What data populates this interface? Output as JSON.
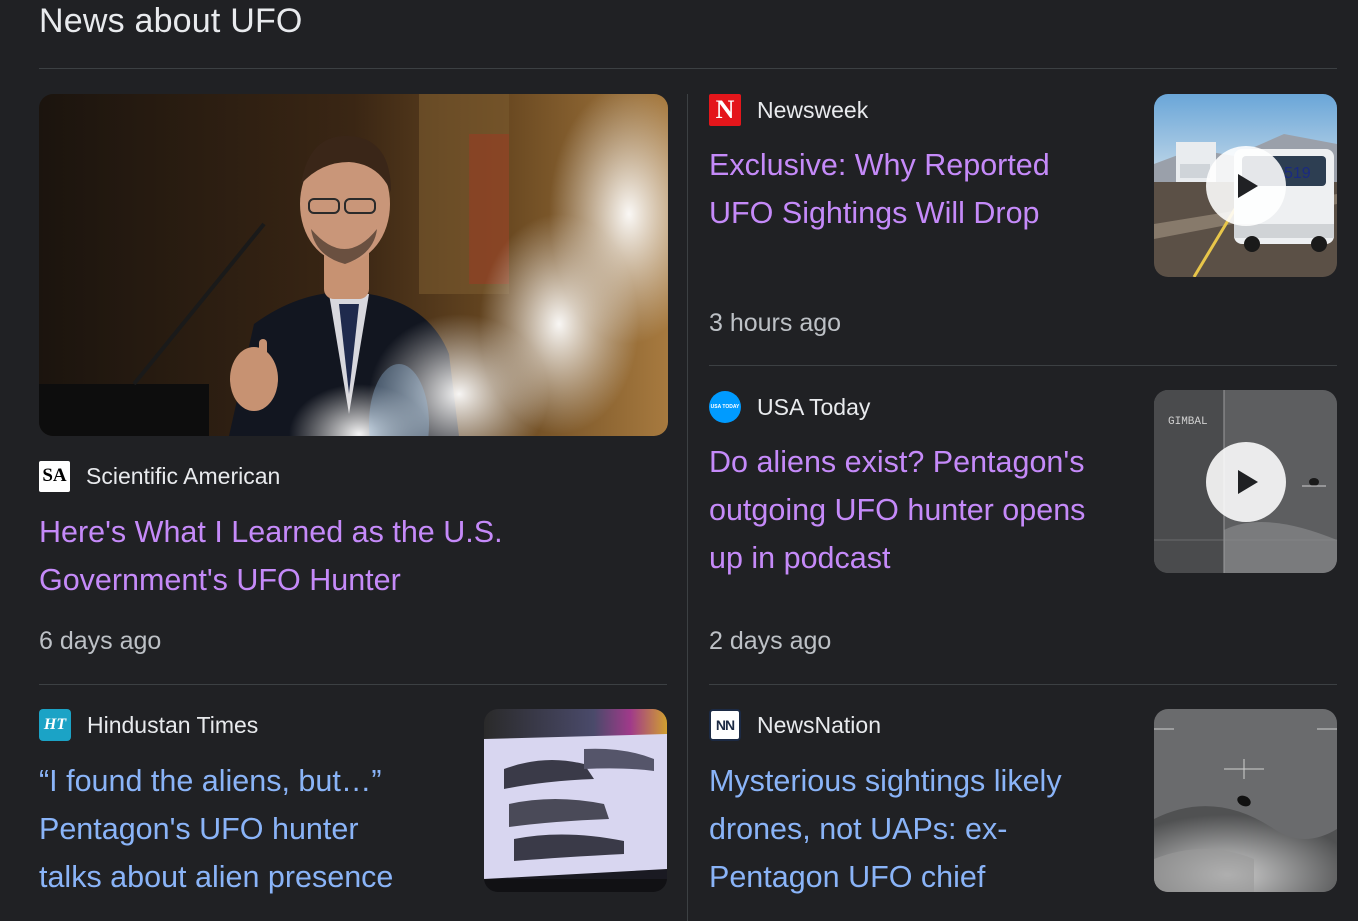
{
  "section": {
    "title": "News about UFO"
  },
  "stories": [
    {
      "source": "Scientific American",
      "logo_text": "SA",
      "headline_line1": "Here's What I Learned as the U.S.",
      "headline_line2": "Government's UFO Hunter",
      "time": "6 days ago",
      "image": "speaker-at-podium-photo",
      "visited": true
    },
    {
      "source": "Newsweek",
      "logo_text": "N",
      "headline_line1": "Exclusive: Why Reported",
      "headline_line2": "UFO Sightings Will Drop",
      "time": "3 hours ago",
      "image": "highway-car-video-thumbnail",
      "has_video": true,
      "visited": true
    },
    {
      "source": "USA Today",
      "logo_text": "USA TODAY",
      "headline_line1": "Do aliens exist? Pentagon's",
      "headline_line2": "outgoing UFO hunter opens",
      "headline_line3": "up in podcast",
      "time": "2 days ago",
      "image": "infrared-ufo-video-thumbnail",
      "thumb_overlay_text": "GIMBAL",
      "has_video": true,
      "visited": true
    },
    {
      "source": "Hindustan Times",
      "logo_text": "HT",
      "headline_line1": "“I found the aliens, but…”",
      "headline_line2": "Pentagon's UFO hunter",
      "headline_line3": "talks about alien presence",
      "image": "alien-bodies-display-photo",
      "visited": false
    },
    {
      "source": "NewsNation",
      "logo_text": "NN",
      "headline_line1": "Mysterious sightings likely",
      "headline_line2": "drones, not UAPs: ex-",
      "headline_line3": "Pentagon UFO chief",
      "image": "infrared-ufo-photo",
      "visited": false
    }
  ],
  "colors": {
    "background": "#202124",
    "visited_link": "#c58af9",
    "unvisited_link": "#8ab4f8",
    "divider": "#3c4043",
    "secondary_text": "#bdc1c6"
  }
}
